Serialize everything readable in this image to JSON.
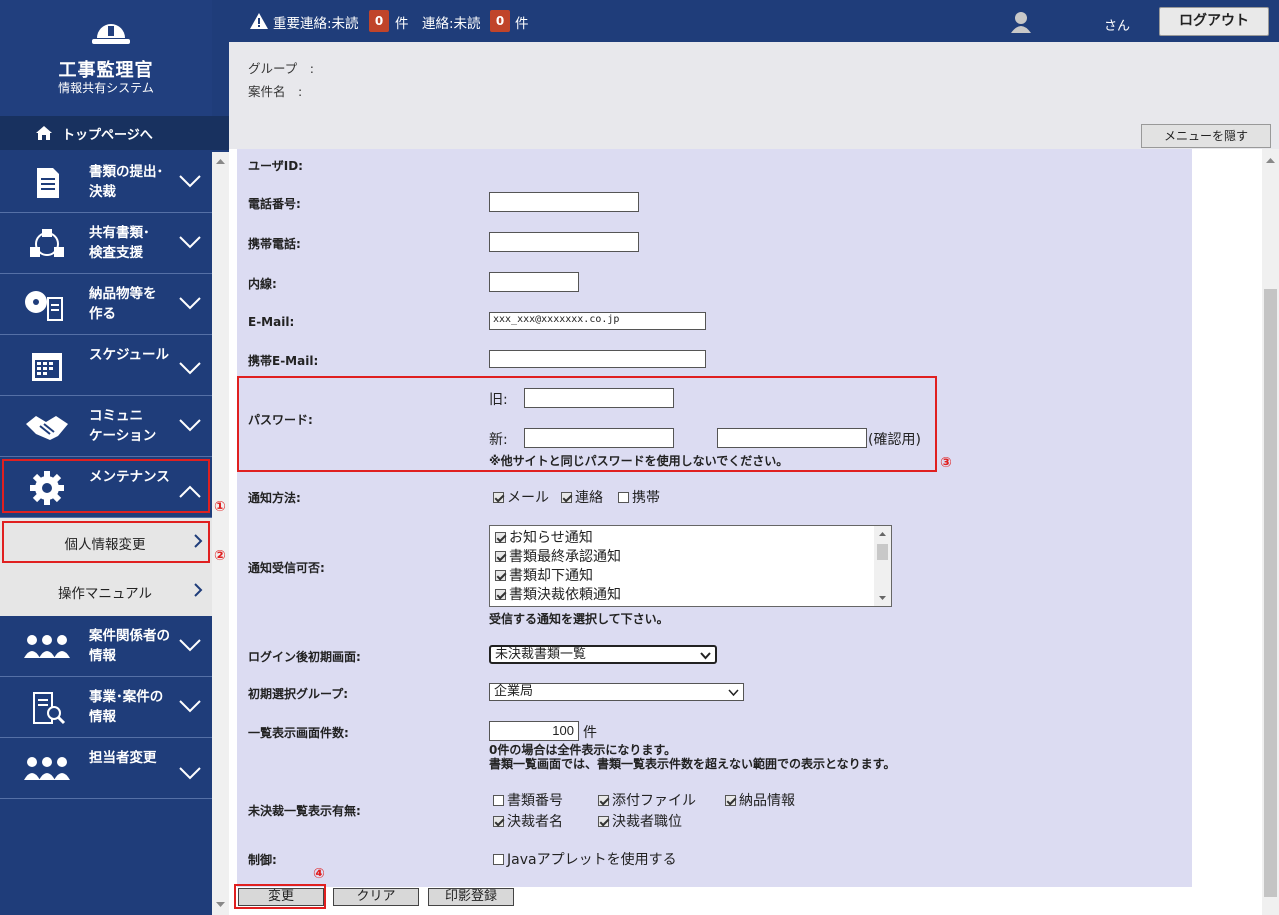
{
  "app": {
    "title": "工事監理官",
    "subtitle": "情報共有システム"
  },
  "header": {
    "important_label": "重要連絡:未読",
    "important_count": "0",
    "unit1": "件",
    "contact_label": "連絡:未読",
    "contact_count": "0",
    "unit2": "件",
    "user_suffix": "さん",
    "logout": "ログアウト"
  },
  "info": {
    "group_label": "グループ　:",
    "project_label": "案件名　:",
    "hide_menu": "メニューを隠す"
  },
  "sidebar": {
    "top_link": "トップページへ",
    "items": [
      {
        "l1": "書類の提出･",
        "l2": "決裁",
        "icon": "document-icon"
      },
      {
        "l1": "共有書類･",
        "l2": "検査支援",
        "icon": "share-icon"
      },
      {
        "l1": "納品物等を",
        "l2": "作る",
        "icon": "disc-doc-icon"
      },
      {
        "l1": "スケジュール",
        "l2": "",
        "icon": "calendar-icon"
      },
      {
        "l1": "コミュニ",
        "l2": "ケーション",
        "icon": "handshake-icon"
      },
      {
        "l1": "メンテナンス",
        "l2": "",
        "icon": "gear-icon"
      }
    ],
    "subitems": [
      "個人情報変更",
      "操作マニュアル"
    ],
    "items2": [
      {
        "l1": "案件関係者の",
        "l2": "情報",
        "icon": "people-icon"
      },
      {
        "l1": "事業･案件の",
        "l2": "情報",
        "icon": "search-doc-icon"
      },
      {
        "l1": "担当者変更",
        "l2": "",
        "icon": "people-change-icon"
      }
    ]
  },
  "form": {
    "user_id": "ユーザID:",
    "phone": "電話番号:",
    "mobile": "携帯電話:",
    "ext": "内線:",
    "email": "E-Mail:",
    "email_value": "xxx_xxx@xxxxxxx.co.jp",
    "mobile_email": "携帯E-Mail:",
    "password": "パスワード:",
    "old": "旧:",
    "new": "新:",
    "confirm": "(確認用)",
    "pw_note": "※他サイトと同じパスワードを使用しないでください。",
    "notify_method": "通知方法:",
    "methods": [
      {
        "label": "メール",
        "checked": true
      },
      {
        "label": "連絡",
        "checked": true
      },
      {
        "label": "携帯",
        "checked": false
      }
    ],
    "notify_recv": "通知受信可否:",
    "notify_items": [
      "お知らせ通知",
      "書類最終承認通知",
      "書類却下通知",
      "書類決裁依頼通知"
    ],
    "notify_note": "受信する通知を選択して下さい。",
    "initial_screen": "ログイン後初期画面:",
    "initial_screen_value": "未決裁書類一覧",
    "initial_group": "初期選択グループ:",
    "initial_group_value": "企業局",
    "list_count": "一覧表示画面件数:",
    "list_count_value": "100",
    "list_unit": "件",
    "list_note1": "0件の場合は全件表示になります。",
    "list_note2": "書類一覧画面では、書類一覧表示件数を超えない範囲での表示となります。",
    "pending_display": "未決裁一覧表示有無:",
    "pending_opts": [
      {
        "label": "書類番号",
        "checked": false
      },
      {
        "label": "添付ファイル",
        "checked": true
      },
      {
        "label": "納品情報",
        "checked": true
      },
      {
        "label": "決裁者名",
        "checked": true
      },
      {
        "label": "決裁者職位",
        "checked": true
      }
    ],
    "control": "制御:",
    "java": "Javaアプレットを使用する",
    "btn_change": "変更",
    "btn_clear": "クリア",
    "btn_stamp": "印影登録"
  },
  "markers": {
    "m1": "①",
    "m2": "②",
    "m3": "③",
    "m4": "④"
  }
}
